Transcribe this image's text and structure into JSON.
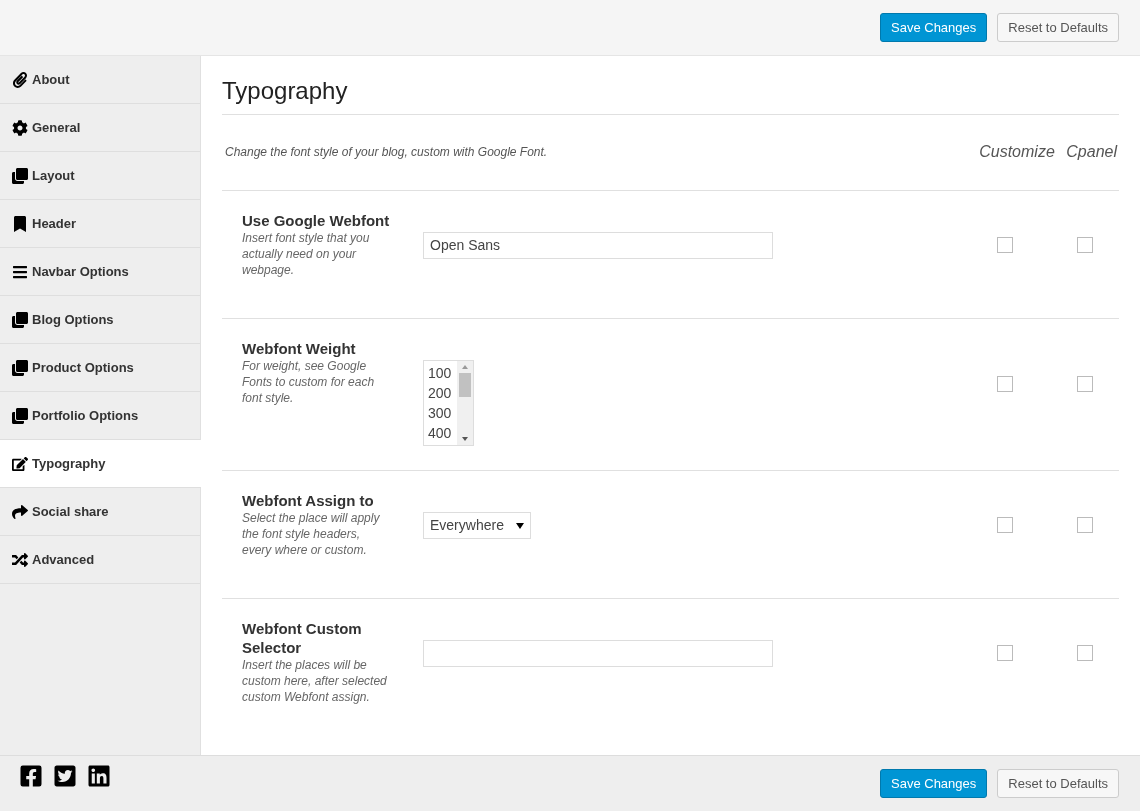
{
  "header": {
    "buttons": [
      {
        "label": "Save Changes",
        "kind": "primary"
      },
      {
        "label": "Reset to Defaults",
        "kind": "secondary"
      }
    ]
  },
  "sidebar": {
    "items": [
      {
        "label": "About",
        "selected": false
      },
      {
        "label": "General",
        "selected": false
      },
      {
        "label": "Layout",
        "selected": false
      },
      {
        "label": "Header",
        "selected": false
      },
      {
        "label": "Navbar Options",
        "selected": false
      },
      {
        "label": "Blog Options",
        "selected": false
      },
      {
        "label": "Product Options",
        "selected": false
      },
      {
        "label": "Portfolio Options",
        "selected": false
      },
      {
        "label": "Typography",
        "selected": true
      },
      {
        "label": "Social share",
        "selected": false
      },
      {
        "label": "Advanced",
        "selected": false
      }
    ]
  },
  "section": {
    "title": "Typography",
    "description": "Change the font style of your blog, custom with Google Font.",
    "columns": [
      "Customize",
      "Cpanel"
    ],
    "options": [
      {
        "title": "Use Google Webfont",
        "help": "Insert font style that you actually need on your webpage.",
        "kind": "text",
        "value": "Open Sans",
        "customize": false,
        "cpanel": false
      },
      {
        "title": "Webfont Weight",
        "help": "For weight, see Google Fonts to custom for each font style.",
        "kind": "listbox",
        "items": [
          {
            "label": "100",
            "selected": false
          },
          {
            "label": "200",
            "selected": false
          },
          {
            "label": "300",
            "selected": false
          },
          {
            "label": "400",
            "selected": false
          }
        ],
        "customize": false,
        "cpanel": false
      },
      {
        "title": "Webfont Assign to",
        "help": "Select the place will apply the font style headers, every where or custom.",
        "kind": "select",
        "value": "Everywhere",
        "customize": false,
        "cpanel": false
      },
      {
        "title": "Webfont Custom Selector",
        "help": "Insert the places will be custom here, after selected custom Webfont assign.",
        "kind": "text",
        "customize": false,
        "cpanel": false
      }
    ]
  },
  "footer": {
    "buttons": [
      {
        "label": "Save Changes",
        "kind": "primary"
      },
      {
        "label": "Reset to Defaults",
        "kind": "secondary"
      }
    ]
  }
}
